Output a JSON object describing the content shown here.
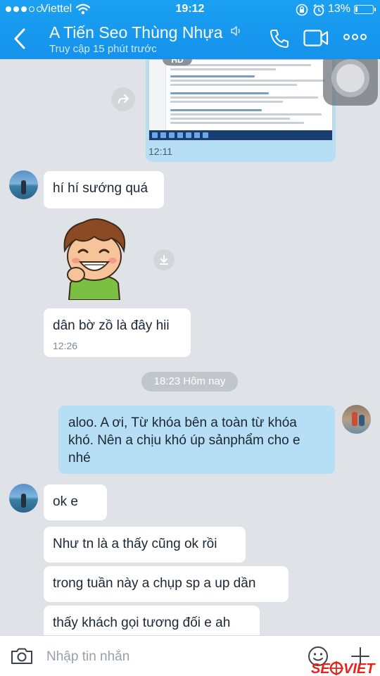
{
  "status_bar": {
    "carrier": "Viettel",
    "time": "19:12",
    "battery_percent": "13%",
    "battery_level": 0.13,
    "signal_bars_filled": 3,
    "icons": [
      "wifi-icon",
      "orientation-lock-icon",
      "alarm-icon",
      "battery-icon"
    ]
  },
  "header": {
    "title": "A Tiến Seo Thùng Nhựa",
    "subtitle": "Truy cập 15 phút trước",
    "icons": [
      "back-icon",
      "mute-icon",
      "phone-icon",
      "video-icon",
      "more-icon"
    ]
  },
  "messages": {
    "image": {
      "badge": "HD",
      "time": "12:11"
    },
    "m1": {
      "text": "hí hí sướng quá"
    },
    "m2": {
      "text": "dân bờ zồ là đây hii",
      "time": "12:26"
    },
    "separator": "18:23 Hôm nay",
    "m3": {
      "text": "aloo. A ơi, Từ khóa bên a toàn từ khóa khó. Nên a chịu khó úp sảnphẩm cho e nhé"
    },
    "m4": {
      "text": "ok e"
    },
    "m5": {
      "text": "Như tn là a thấy cũng ok rồi"
    },
    "m6": {
      "text": "trong tuần này a chụp sp a up dần"
    },
    "m7": {
      "text": "thấy khách gọi tương đối e ah"
    }
  },
  "composer": {
    "placeholder": "Nhập tin nhắn",
    "icons": [
      "camera-icon",
      "emoji-icon",
      "plus-icon"
    ]
  },
  "watermark": {
    "text": "SEOVIET"
  },
  "colors": {
    "header": "#1592ea",
    "chat_background": "#dfe3e8",
    "outgoing_bubble": "#b6def5",
    "incoming_bubble": "#ffffff",
    "watermark": "#e5231b"
  }
}
